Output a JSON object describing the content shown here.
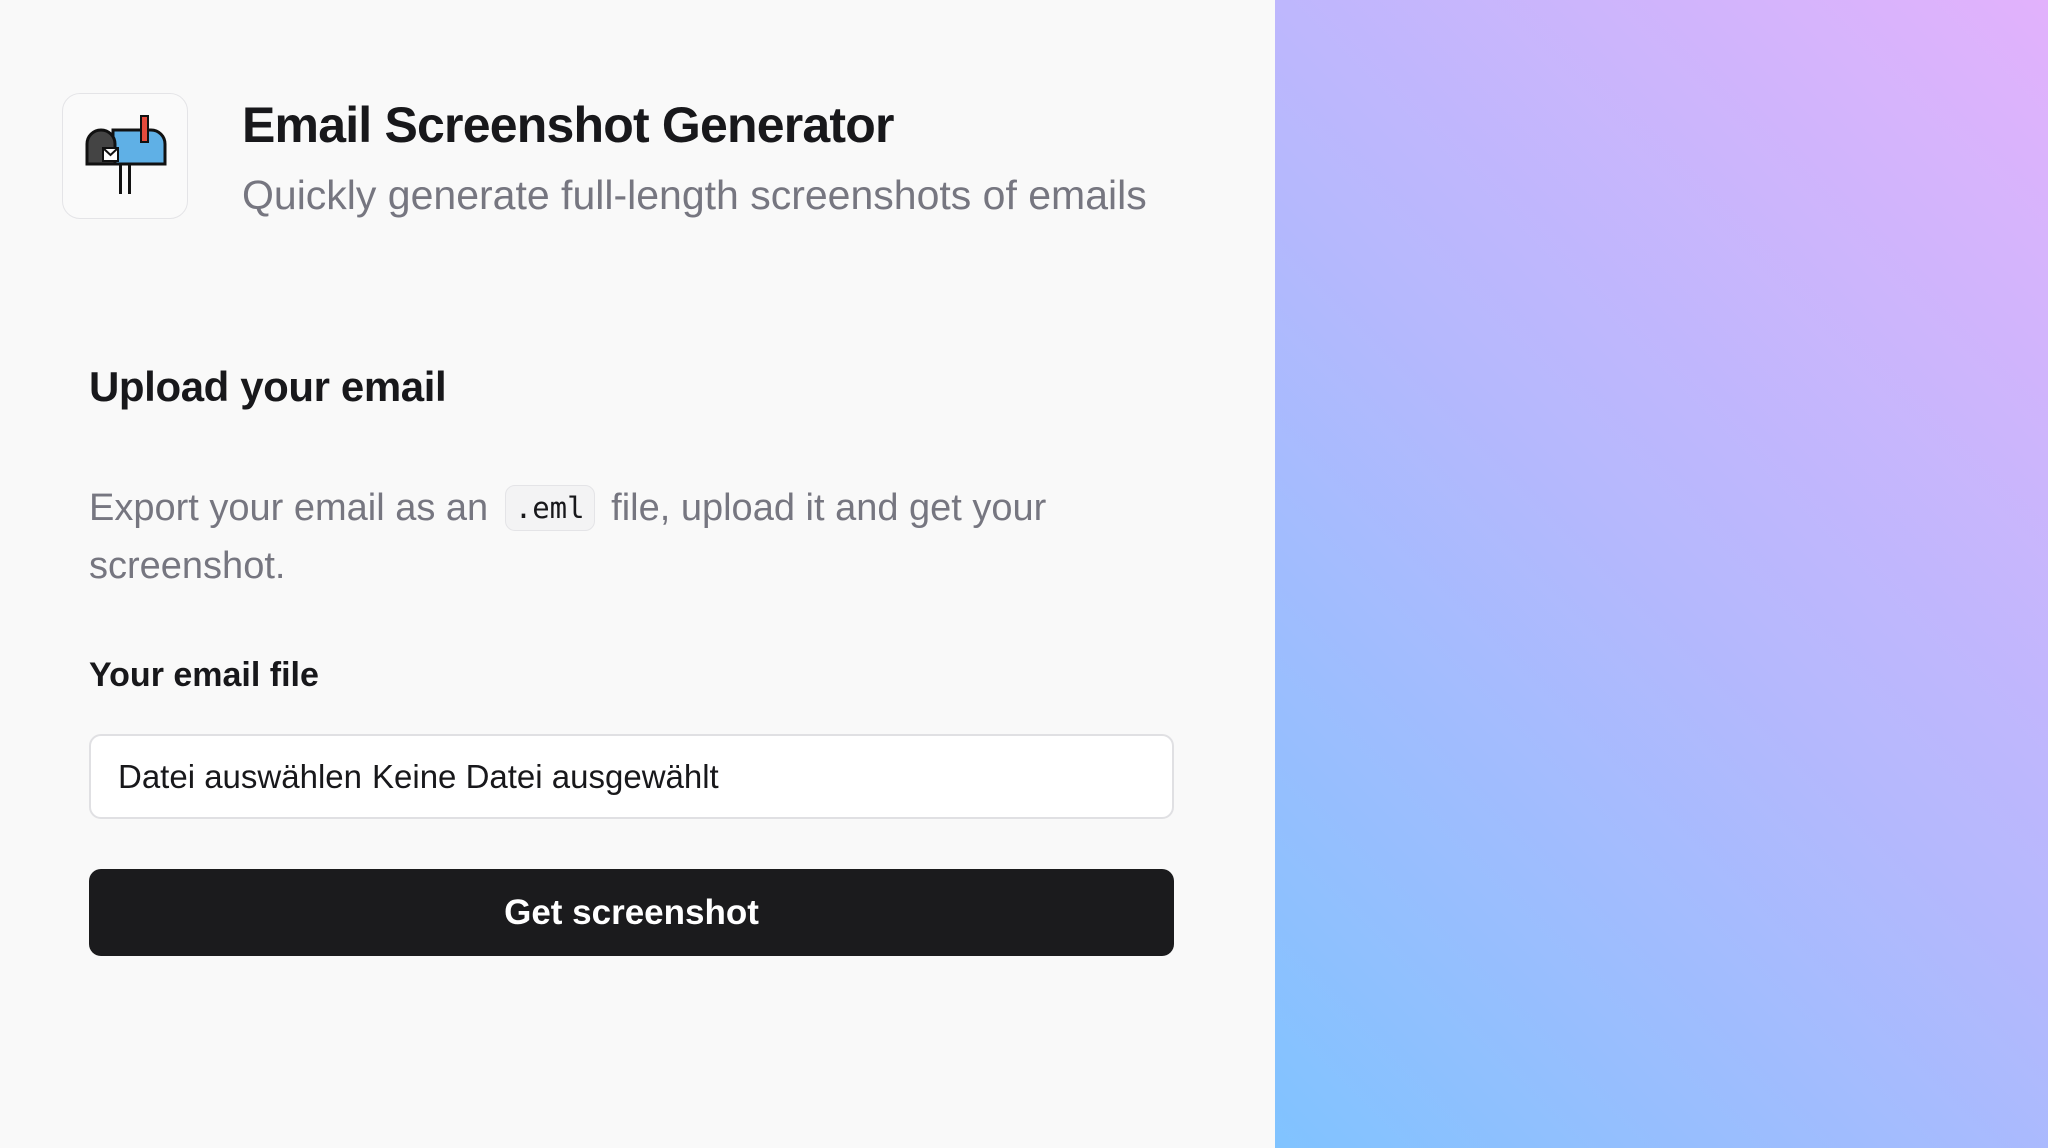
{
  "header": {
    "logo_icon": "mailbox-icon",
    "title": "Email Screenshot Generator",
    "subtitle": "Quickly generate full-length screenshots of emails"
  },
  "upload": {
    "section_title": "Upload your email",
    "description_before": "Export your email as an",
    "description_code": ".eml",
    "description_after": "file, upload it and get your screenshot.",
    "field_label": "Your email file",
    "file_button_label": "Datei auswählen",
    "file_status": "Keine Datei ausgewählt",
    "submit_label": "Get screenshot"
  },
  "colors": {
    "background": "#f9f9f9",
    "button": "#1b1b1d",
    "gradient_start": "#80c3ff",
    "gradient_end": "#e2b2fc"
  }
}
